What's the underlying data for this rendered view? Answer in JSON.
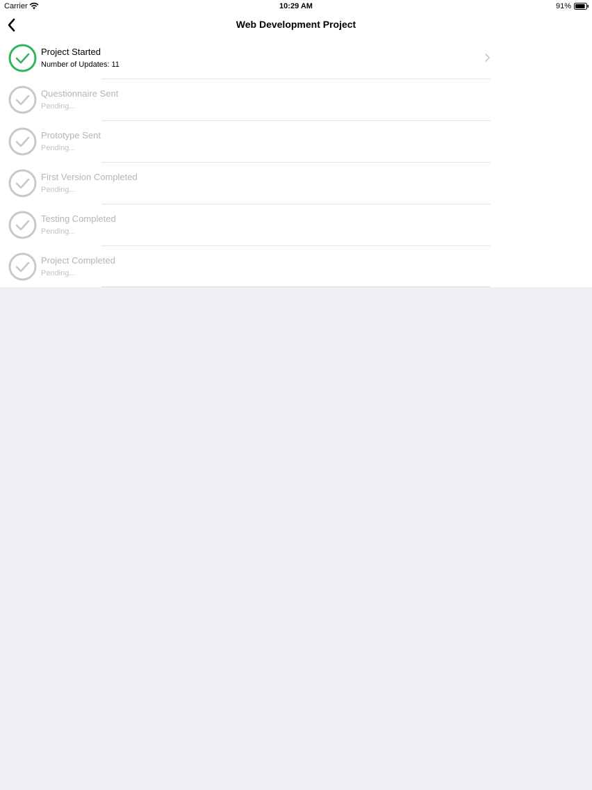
{
  "status_bar": {
    "carrier": "Carrier",
    "time": "10:29 AM",
    "battery_percent": "91%",
    "battery_level": 0.91,
    "icons": [
      "wifi-icon",
      "battery-icon"
    ]
  },
  "nav": {
    "title": "Web Development Project",
    "back_icon": "chevron-left-icon"
  },
  "colors": {
    "done": "#2fb65d",
    "pending": "#c8c8cc"
  },
  "steps": [
    {
      "title": "Project Started",
      "subtitle": "Number of Updates: 11",
      "status": "done"
    },
    {
      "title": "Questionnaire Sent",
      "subtitle": "Pending...",
      "status": "pending"
    },
    {
      "title": "Prototype Sent",
      "subtitle": "Pending...",
      "status": "pending"
    },
    {
      "title": "First Version Completed",
      "subtitle": "Pending...",
      "status": "pending"
    },
    {
      "title": "Testing Completed",
      "subtitle": "Pending...",
      "status": "pending"
    },
    {
      "title": "Project Completed",
      "subtitle": "Pending...",
      "status": "pending"
    }
  ]
}
